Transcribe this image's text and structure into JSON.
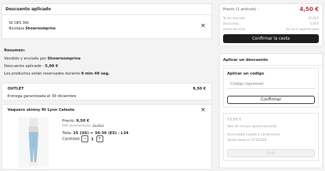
{
  "applied": {
    "title": "Descuento aplicado",
    "code": "5€ DES 30€",
    "shop_prefix": "Boutique",
    "shop_name": "Showroomprive",
    "close_glyph": "×"
  },
  "summary": {
    "title": "Resumen:",
    "seller_prefix": "Vendido y enviado por",
    "seller": "Showroomprive",
    "discount_label": "Descuento aplicado -",
    "discount_value": "5,00 €",
    "reserved_prefix": "Los productos están reservados durante",
    "reserved_time": "9 min 49 seg."
  },
  "outlet": {
    "title": "OUTLET",
    "price": "9,50 €",
    "delivery": "Entrega garantizada el 30 diciembre"
  },
  "product": {
    "name": "Vaquero skinny fit Lynn Celeste",
    "price_label": "Precio:",
    "price": "9,50 €",
    "pvp_label": "PVP recomendado:",
    "pvp_value": "39,99 €",
    "size_label": "Talla:",
    "size_value": "25 (US) = 34-36 (ES) - L34",
    "qty_label": "Cantidad:",
    "qty_minus": "−",
    "qty_value": "1",
    "qty_plus": "+",
    "close_glyph": "×",
    "image_icon": "jeans-model-photo"
  },
  "totals": {
    "price_label": "Precio (1 artículo) :",
    "price_value": "4,50 €",
    "saved_label": "Te has ahorrado",
    "saved_value": "-35,49 €",
    "discounts_label": "Descuentos",
    "discounts_value": "-5,00 €",
    "shipping_label": "Gastos de envío",
    "shipping_value": "Ver en el siguiente paso",
    "confirm_button": "Confirmar la cesta"
  },
  "discount_panel": {
    "title": "Aplicar un descuento",
    "code_title": "Aplicar un código",
    "code_placeholder": "Código (opcional)",
    "confirm_button": "Confirmar",
    "voucher_amount": "15,00 €",
    "voucher_desc": "Vale de compra apadrinamiento",
    "voucher_note": "Acumulable (sujeto a condiciones)",
    "voucher_valid": "Válido hasta el 27/3/2026",
    "apply_button": "Usar"
  },
  "colors": {
    "accent_red": "#e3262e",
    "dark_button": "#1e1e1e"
  }
}
